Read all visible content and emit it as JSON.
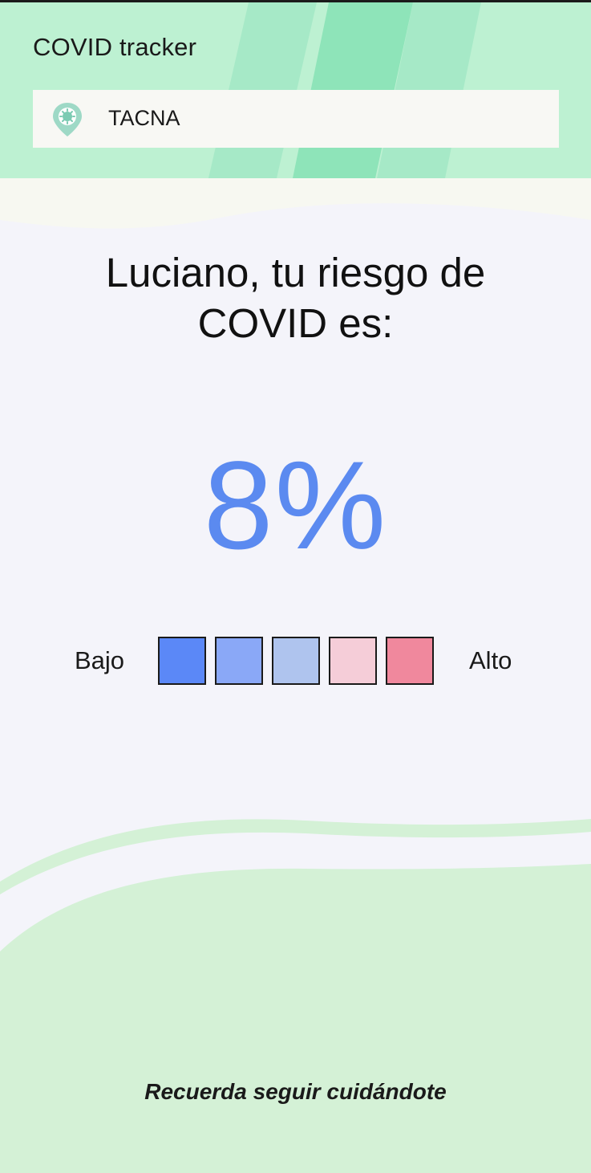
{
  "header": {
    "title": "COVID tracker",
    "location": "TACNA",
    "location_icon": "map-pin-icon"
  },
  "main": {
    "heading": "Luciano, tu riesgo de COVID es:",
    "risk_value": "8%",
    "risk_percent": 8,
    "scale": {
      "low_label": "Bajo",
      "high_label": "Alto",
      "levels": [
        "#5b88f7",
        "#8aa8f7",
        "#afc4ee",
        "#f5cdd8",
        "#f0889d"
      ]
    }
  },
  "footer": {
    "message": "Recuerda seguir cuidándote"
  },
  "colors": {
    "header_bg": "#bdf1d2",
    "accent": "#5b8af0",
    "footer_bg": "#d4f1d6",
    "page_bg": "#f4f4fa"
  }
}
